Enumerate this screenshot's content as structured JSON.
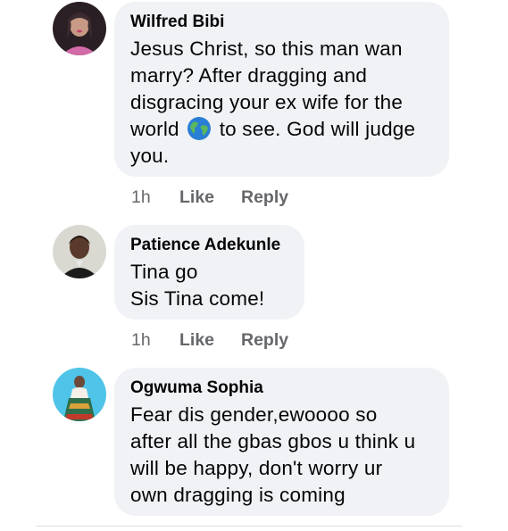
{
  "comments": [
    {
      "author": "Wilfred Bibi",
      "lines": [
        "Jesus Christ, so this man wan",
        "marry? After dragging and",
        "disgracing your ex wife for the"
      ],
      "line4_before": "world",
      "line4_emoji": "globe-emoji",
      "line4_after": "to see. God will judge",
      "line5": "you.",
      "time": "1h",
      "like": "Like",
      "reply": "Reply"
    },
    {
      "author": "Patience Adekunle",
      "lines": [
        "Tina go",
        "Sis Tina come!"
      ],
      "time": "1h",
      "like": "Like",
      "reply": "Reply"
    },
    {
      "author": "Ogwuma Sophia",
      "lines": [
        "Fear dis gender,ewoooo so",
        "after all the gbas gbos u think u",
        "will be happy, don't worry ur",
        "own dragging is coming"
      ]
    }
  ],
  "colors": {
    "bubble": "#f0f2f5",
    "action_text": "#65676b",
    "text": "#050505"
  }
}
